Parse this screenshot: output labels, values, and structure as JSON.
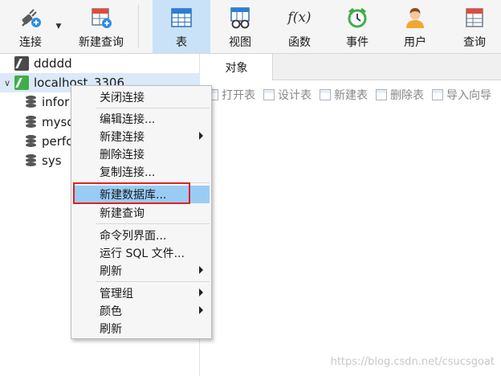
{
  "toolbar": {
    "connect": "连接",
    "new_query": "新建查询",
    "table": "表",
    "view": "视图",
    "function": "函数",
    "event": "事件",
    "user": "用户",
    "query": "查询",
    "function_glyph": "f(x)"
  },
  "tree": {
    "connections": [
      {
        "label": "ddddd",
        "icon": "connection-icon"
      },
      {
        "label": "localhost_3306",
        "icon": "connection-green-icon"
      }
    ],
    "databases": [
      {
        "label": "infor"
      },
      {
        "label": "mysc"
      },
      {
        "label": "perfo"
      },
      {
        "label": "sys"
      }
    ]
  },
  "tabs": {
    "objects": "对象"
  },
  "object_toolbar": {
    "open_table": "打开表",
    "design_table": "设计表",
    "new_table": "新建表",
    "delete_table": "删除表",
    "import_wizard": "导入向导"
  },
  "context_menu": {
    "close_connection": "关闭连接",
    "edit_connection": "编辑连接...",
    "new_connection": "新建连接",
    "delete_connection": "删除连接",
    "copy_connection": "复制连接...",
    "new_database": "新建数据库...",
    "new_query": "新建查询",
    "console": "命令列界面...",
    "run_sql": "运行 SQL 文件...",
    "refresh_sub": "刷新",
    "manage_group": "管理组",
    "color": "颜色",
    "refresh": "刷新"
  },
  "watermark": "https://blog.csdn.net/csucsgoat",
  "colors": {
    "active_tab": "#c9e2f7",
    "menu_highlight": "#99ccf5",
    "callout": "#e32020",
    "connected": "#3fae48"
  }
}
